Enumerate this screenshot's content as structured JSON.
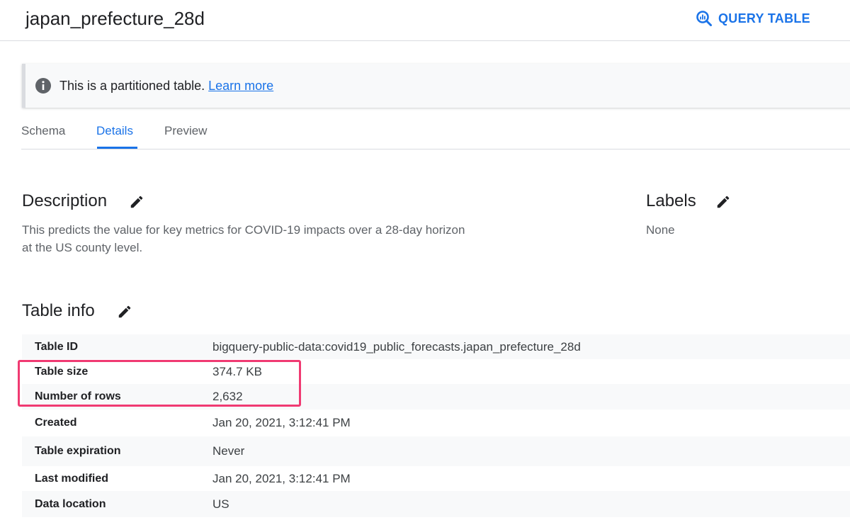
{
  "header": {
    "title": "japan_prefecture_28d",
    "query_label": "QUERY TABLE"
  },
  "banner": {
    "text": "This is a partitioned table.",
    "link": "Learn more"
  },
  "tabs": [
    {
      "label": "Schema"
    },
    {
      "label": "Details"
    },
    {
      "label": "Preview"
    }
  ],
  "active_tab": "Details",
  "description": {
    "title": "Description",
    "line1": "This predicts the value for key metrics for COVID-19 impacts over a 28-day horizon",
    "line2": "at the US county level."
  },
  "labels": {
    "title": "Labels",
    "value": "None"
  },
  "table_info": {
    "title": "Table info",
    "rows": [
      {
        "key": "Table ID",
        "value": "bigquery-public-data:covid19_public_forecasts.japan_prefecture_28d"
      },
      {
        "key": "Table size",
        "value": "374.7 KB"
      },
      {
        "key": "Number of rows",
        "value": "2,632"
      },
      {
        "key": "Created",
        "value": "Jan 20, 2021, 3:12:41 PM"
      },
      {
        "key": "Table expiration",
        "value": "Never"
      },
      {
        "key": "Last modified",
        "value": "Jan 20, 2021, 3:12:41 PM"
      },
      {
        "key": "Data location",
        "value": "US"
      }
    ]
  },
  "colors": {
    "accent": "#1a73e8",
    "highlight": "#f03a72"
  }
}
